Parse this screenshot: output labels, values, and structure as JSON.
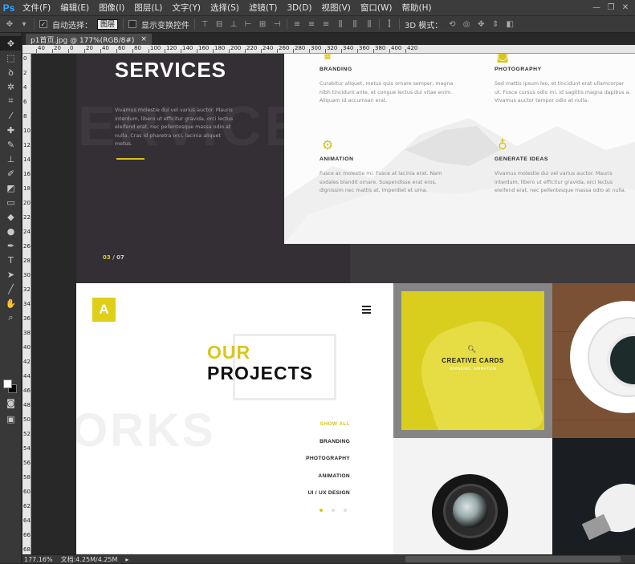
{
  "app": {
    "logo": "Ps"
  },
  "menu": [
    "文件(F)",
    "编辑(E)",
    "图像(I)",
    "图层(L)",
    "文字(Y)",
    "选择(S)",
    "滤镜(T)",
    "3D(D)",
    "视图(V)",
    "窗口(W)",
    "帮助(H)"
  ],
  "window_controls": [
    "—",
    "❐",
    "✕"
  ],
  "options": {
    "auto_select_label": "自动选择：",
    "auto_select_value": "图层",
    "show_transform_label": "显示变换控件",
    "mode_3d_label": "3D 模式："
  },
  "document": {
    "tab_title": "p1首页.jpg @ 177%(RGB/8#)",
    "close": "×"
  },
  "ruler_h": [
    "40",
    "20",
    "0",
    "20",
    "40",
    "60",
    "80",
    "100",
    "120",
    "140",
    "160",
    "180",
    "200",
    "220",
    "240",
    "260",
    "280",
    "300",
    "320",
    "340",
    "360",
    "380",
    "400",
    "420"
  ],
  "ruler_v": [
    "0",
    "2",
    "4",
    "6",
    "8",
    "10",
    "12",
    "14",
    "16",
    "18",
    "20",
    "22",
    "24",
    "26",
    "28",
    "30",
    "32",
    "34",
    "36",
    "38",
    "40",
    "42",
    "44",
    "46",
    "48",
    "50",
    "52",
    "54",
    "56",
    "58",
    "60",
    "62",
    "64",
    "66",
    "68"
  ],
  "tools": [
    "move-icon",
    "marquee-icon",
    "lasso-icon",
    "magic-wand-icon",
    "crop-icon",
    "eyedropper-icon",
    "healing-icon",
    "brush-icon",
    "stamp-icon",
    "history-brush-icon",
    "eraser-icon",
    "gradient-icon",
    "blur-icon",
    "dodge-icon",
    "pen-icon",
    "type-icon",
    "path-select-icon",
    "line-icon",
    "hand-icon",
    "zoom-icon"
  ],
  "services": {
    "title": "SERVICES",
    "ghost": "ERVICE",
    "text": "Vivamus molestie dui vel varius auctor. Mauris interdum, libero ut efficitur gravida, orci lectus eleifend erat, nec pellentesque massa odio at nulla. Cras id pharetra orci, lacinia aliquet metus.",
    "pager_current": "03",
    "pager_total": "/ 07",
    "items": [
      {
        "icon": "trophy-icon",
        "title": "BRANDING",
        "text": "Curabitur aliquet, metus quis ornare semper, magna nibh tincidunt ante, et congue lectus dui vitae enim. Aliquam id accumsan erat."
      },
      {
        "icon": "camera-icon",
        "title": "PHOTOGRAPHY",
        "text": "Sed mattis ipsum leo, et tincidunt erat ullamcorper ut. Fusce cursus odio mi, id sagittis magna dapibus a. Vivamus auctor tempor odio at nulla."
      },
      {
        "icon": "gear-icon",
        "title": "ANIMATION",
        "text": "Fusce ac molestie mi. Fusce at lacinia erat. Nam sodales blandit ornare. Suspendisse erat eros, dignissim nec mattis at, imperdiet et urna."
      },
      {
        "icon": "lightbulb-icon",
        "title": "GENERATE IDEAS",
        "text": "Vivamus molestie dui vel varius auctor. Mauris interdum, libero ut efficitur gravida, orci lectus eleifend erat, nec pellentesque massa odio at nulla."
      }
    ]
  },
  "projects": {
    "logo": "A",
    "title_accent": "OUR",
    "title": "PROJECTS",
    "ghost": "ORKS",
    "nav": [
      "SHOW ALL",
      "BRANDING",
      "PHOTOGRAPHY",
      "ANIMATION",
      "UI / UX DESIGN"
    ],
    "card_title": "CREATIVE CARDS",
    "card_sub": "BRANDING, ANIMATION"
  },
  "status": {
    "zoom": "177.16%",
    "doc_size": "文档:4.25M/4.25M"
  },
  "colors": {
    "accent": "#d9c71a",
    "ps_blue": "#31a8ff"
  }
}
